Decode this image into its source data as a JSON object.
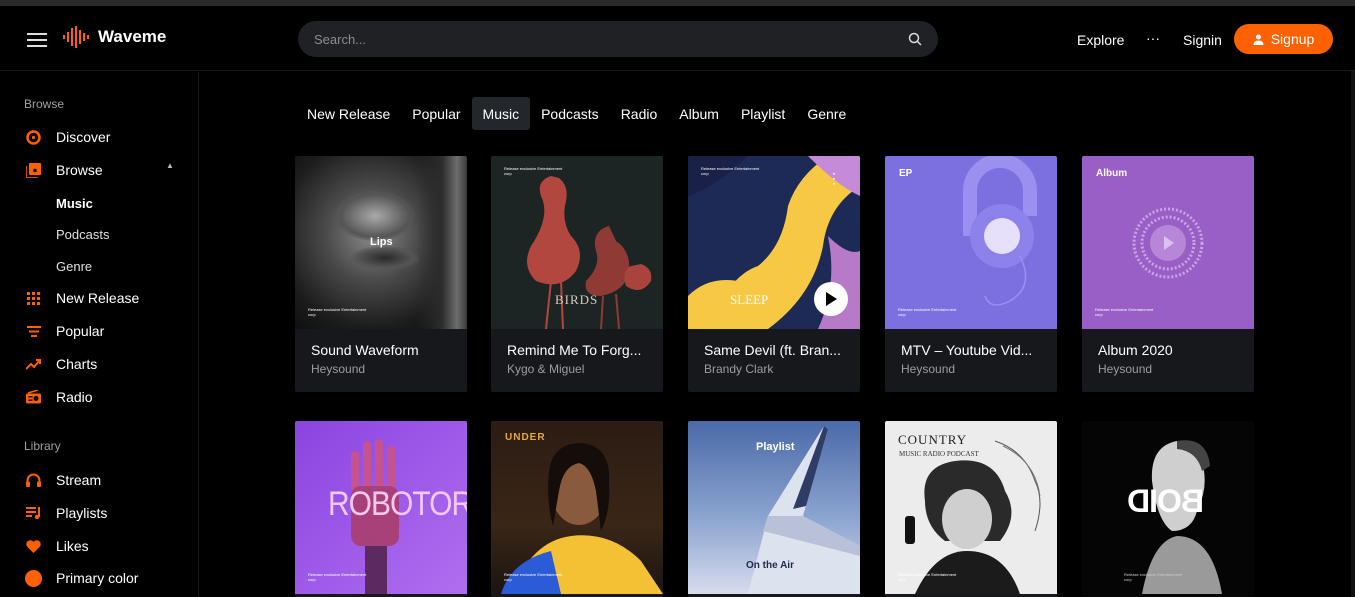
{
  "app": {
    "name": "Waveme"
  },
  "header": {
    "search_placeholder": "Search...",
    "explore": "Explore",
    "more": "···",
    "signin": "Signin",
    "signup": "Signup"
  },
  "sidebar": {
    "browse_title": "Browse",
    "items": [
      {
        "label": "Discover",
        "icon": "disc-icon"
      },
      {
        "label": "Browse",
        "icon": "browse-icon"
      },
      {
        "label": "New Release",
        "icon": "grid-icon"
      },
      {
        "label": "Popular",
        "icon": "list-icon"
      },
      {
        "label": "Charts",
        "icon": "chart-icon"
      },
      {
        "label": "Radio",
        "icon": "radio-icon"
      }
    ],
    "browse_sub": [
      "Music",
      "Podcasts",
      "Genre"
    ],
    "library_title": "Library",
    "library": [
      {
        "label": "Stream",
        "icon": "headphones-icon"
      },
      {
        "label": "Playlists",
        "icon": "playlist-icon"
      },
      {
        "label": "Likes",
        "icon": "heart-icon"
      },
      {
        "label": "Primary color",
        "icon": "color-dot-icon"
      }
    ]
  },
  "tabs": [
    "New Release",
    "Popular",
    "Music",
    "Podcasts",
    "Radio",
    "Album",
    "Playlist",
    "Genre"
  ],
  "active_tab": "Music",
  "cards_row1": [
    {
      "title": "Sound Waveform",
      "artist": "Heysound",
      "art_text": "Lips",
      "small_print": "Release exclusive Entertainment corp"
    },
    {
      "title": "Remind Me To Forg...",
      "artist": "Kygo & Miguel",
      "art_text": "BIRDS",
      "small_print": "Release exclusive Entertainment corp"
    },
    {
      "title": "Same Devil (ft. Bran...",
      "artist": "Brandy Clark",
      "art_text": "SLEEP",
      "small_print": "Release exclusive Entertainment corp"
    },
    {
      "title": "MTV – Youtube Vid...",
      "artist": "Heysound",
      "art_text": "EP",
      "small_print": "Release exclusive Entertainment corp"
    },
    {
      "title": "Album 2020",
      "artist": "Heysound",
      "art_text": "Album",
      "small_print": "Release exclusive Entertainment corp"
    }
  ],
  "cards_row2": [
    {
      "art_text": "ROBOTOR",
      "small_print": "Release exclusive Entertainment corp"
    },
    {
      "art_text": "UNDER",
      "small_print": "Release exclusive Entertainment corp"
    },
    {
      "art_text": "Playlist",
      "art_text2": "On the Air"
    },
    {
      "art_text": "COUNTRY",
      "art_text2": "MUSIC RADIO PODCAST",
      "small_print": "Release exclusive Entertainment corp"
    },
    {
      "art_text": "BOID",
      "small_print": "Release exclusive Entertainment corp"
    }
  ],
  "colors": {
    "accent": "#ff6000",
    "bg": "#000000",
    "card": "#16181b"
  }
}
